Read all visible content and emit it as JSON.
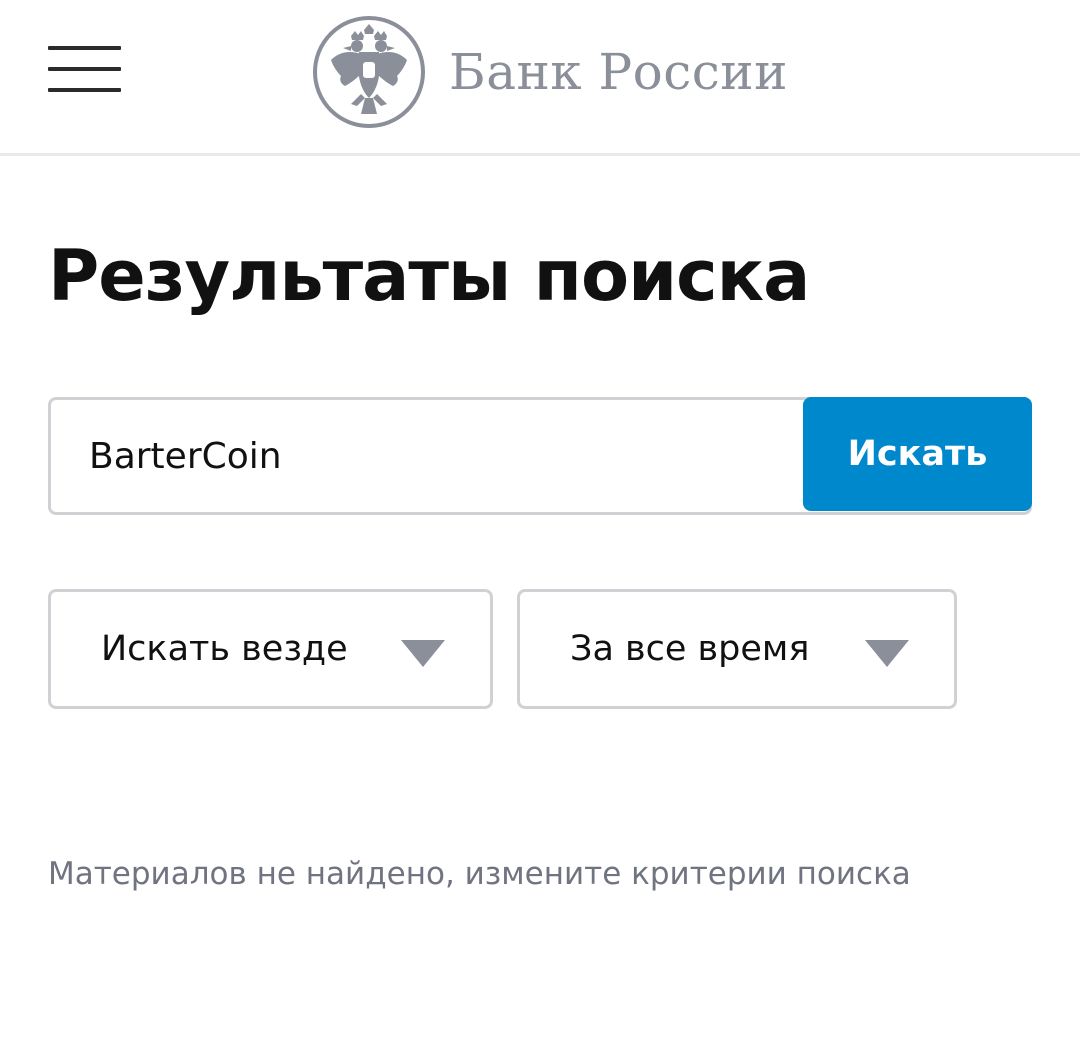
{
  "header": {
    "logo_text": "Банк России",
    "logo_icon": "double-headed-eagle-emblem",
    "menu_icon": "hamburger-menu-icon"
  },
  "page": {
    "title": "Результаты поиска"
  },
  "search": {
    "value": "BarterCoin",
    "button_label": "Искать"
  },
  "filters": {
    "scope": {
      "selected": "Искать везде",
      "icon": "triangle-down-icon"
    },
    "period": {
      "selected": "За все время",
      "icon": "triangle-down-icon"
    }
  },
  "results": {
    "empty_message": "Материалов не найдено, измените критерии поиска"
  },
  "colors": {
    "accent": "#0088cc",
    "logo_gray": "#8a8f99",
    "border": "#cfd1d4",
    "muted_text": "#6f7480"
  }
}
